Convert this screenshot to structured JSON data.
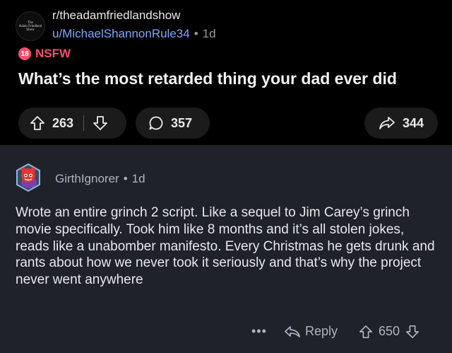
{
  "post": {
    "subreddit": "r/theadamfriedlandshow",
    "subreddit_icon_text": [
      "The",
      "Adam Friedland",
      "Show"
    ],
    "author": "u/MichaelShannonRule34",
    "separator": "•",
    "time": "1d",
    "nsfw_badge": "18",
    "nsfw_label": "NSFW",
    "title": "What’s the most retarded thing your dad ever did",
    "upvotes": "263",
    "comments": "357",
    "shares": "344"
  },
  "comment": {
    "author": "GirthIgnorer",
    "separator": "•",
    "time": "1d",
    "body": "Wrote an entire grinch 2 script. Like a sequel to Jim Carey’s grinch movie specifically. Took him like 8 months and it’s all stolen jokes, reads like a unabomber manifesto. Every Christmas he gets drunk and rants about how we never took it seriously and that’s why the project never went anywhere",
    "more_label": "•••",
    "reply_label": "Reply",
    "votes": "650"
  },
  "colors": {
    "post_bg": "#000000",
    "comment_bg": "#1f2229",
    "nsfw": "#ff4a6b",
    "author_link": "#7fa8ff",
    "pill_bg": "#1b1b1b"
  },
  "icons": [
    "upvote-icon",
    "downvote-icon",
    "comment-bubble-icon",
    "share-arrow-icon",
    "reply-arrow-icon",
    "snoo-avatar-icon",
    "subreddit-icon"
  ]
}
